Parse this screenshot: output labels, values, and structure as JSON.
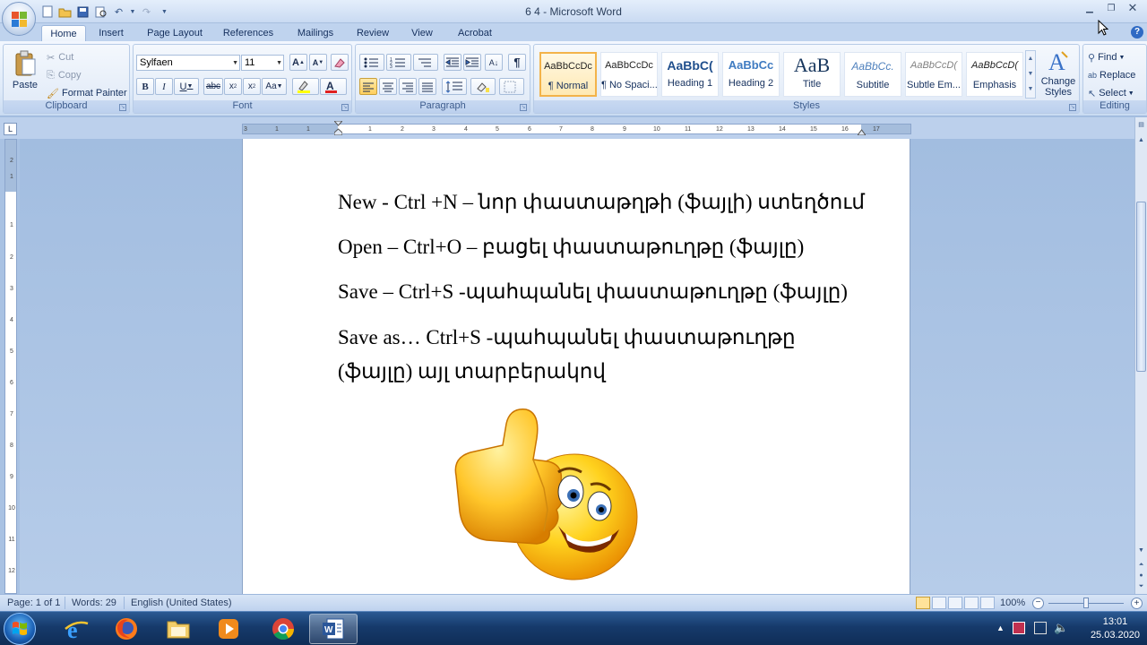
{
  "window": {
    "title": "6 4 - Microsoft Word"
  },
  "tabs": [
    "Home",
    "Insert",
    "Page Layout",
    "References",
    "Mailings",
    "Review",
    "View",
    "Acrobat"
  ],
  "clipboard": {
    "paste": "Paste",
    "cut": "Cut",
    "copy": "Copy",
    "format_painter": "Format Painter",
    "label": "Clipboard"
  },
  "font": {
    "name": "Sylfaen",
    "size": "11",
    "label": "Font"
  },
  "paragraph": {
    "label": "Paragraph"
  },
  "styles": {
    "label": "Styles",
    "items": [
      {
        "sample": "AaBbCcDc",
        "name": "¶ Normal"
      },
      {
        "sample": "AaBbCcDc",
        "name": "¶ No Spaci..."
      },
      {
        "sample": "AaBbC(",
        "name": "Heading 1"
      },
      {
        "sample": "AaBbCc",
        "name": "Heading 2"
      },
      {
        "sample": "AaB",
        "name": "Title"
      },
      {
        "sample": "AaBbCc.",
        "name": "Subtitle"
      },
      {
        "sample": "AaBbCcD(",
        "name": "Subtle Em..."
      },
      {
        "sample": "AaBbCcD(",
        "name": "Emphasis"
      }
    ],
    "change_styles": "Change Styles"
  },
  "editing": {
    "find": "Find",
    "replace": "Replace",
    "select": "Select",
    "label": "Editing"
  },
  "ruler": {
    "numbers": [
      "3",
      "1",
      "2",
      "1",
      "1",
      "2",
      "3",
      "4",
      "5",
      "6",
      "7",
      "8",
      "9",
      "10",
      "11",
      "12",
      "13",
      "14",
      "15",
      "16",
      "17"
    ]
  },
  "vruler": {
    "numbers": [
      "2",
      "1",
      "1",
      "2",
      "3",
      "4",
      "5",
      "6",
      "7",
      "8",
      "9",
      "10",
      "11",
      "12",
      "13",
      "14",
      "15"
    ]
  },
  "document": {
    "lines": [
      "New - Ctrl +N – նոր փաստաթղթի (ֆայլի) ստեղծում",
      "Open – Ctrl+O – բացել փաստաթուղթը (ֆայլը)",
      "Save – Ctrl+S -պահպանել փաստաթուղթը (ֆայլը)",
      "Save as… Ctrl+S -պահպանել փաստաթուղթը",
      "(ֆայլը) այլ տարբերակով"
    ]
  },
  "status": {
    "page": "Page: 1 of 1",
    "words": "Words: 29",
    "language": "English (United States)",
    "zoom": "100%"
  },
  "taskbar": {
    "time": "13:01",
    "date": "25.03.2020"
  }
}
